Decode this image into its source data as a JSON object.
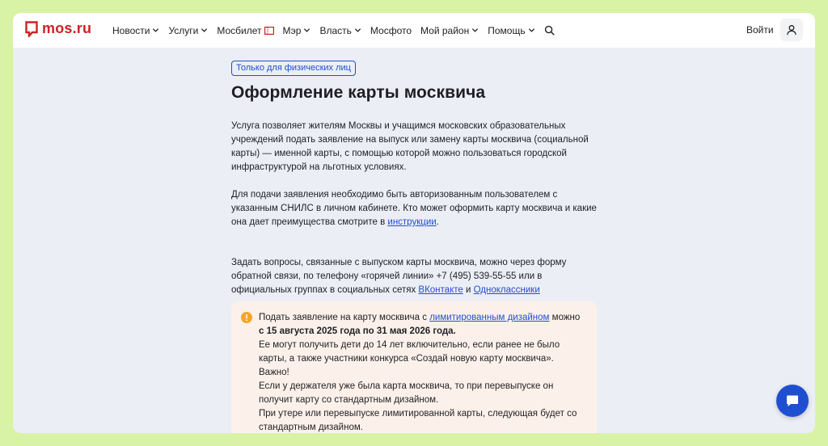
{
  "header": {
    "logo_text": "mos.ru",
    "nav": [
      {
        "label": "Новости",
        "has_dropdown": true
      },
      {
        "label": "Услуги",
        "has_dropdown": true
      },
      {
        "label": "Мосбилет",
        "has_dropdown": false
      },
      {
        "label": "Мэр",
        "has_dropdown": true
      },
      {
        "label": "Власть",
        "has_dropdown": true
      },
      {
        "label": "Мосфото",
        "has_dropdown": false
      },
      {
        "label": "Мой район",
        "has_dropdown": true
      },
      {
        "label": "Помощь",
        "has_dropdown": true
      }
    ],
    "login_label": "Войти"
  },
  "main": {
    "badge": "Только для физических лиц",
    "title": "Оформление карты москвича",
    "intro": "Услуга позволяет жителям Москвы и учащимся московских образовательных учреждений подать заявление на выпуск или замену карты москвича (социальной карты) — именной карты, с помощью которой можно пользоваться городской инфраструктурой на льготных условиях.",
    "auth_text": "Для подачи заявления необходимо быть авторизованным пользователем с указанным СНИЛС в личном кабинете. Кто может оформить карту москвича и какие она дает преимущества смотрите в ",
    "auth_link": "инструкции",
    "auth_end": ".",
    "contact_text": "Задать вопросы, связанные с выпуском карты москвича, можно через форму обратной связи, по телефону «горячей линии» +7 (495) 539-55-55 или в официальных группах в социальных сетях ",
    "vk_link": "ВКонтакте",
    "and_word": " и ",
    "ok_link": "Одноклассники"
  },
  "notice": {
    "line1_start": "Подать заявление на карту москвича с ",
    "line1_link": "лимитированным дизайном",
    "line1_end": " можно",
    "dates": "с 15 августа 2025 года по 31 мая 2026 года.",
    "eligible": "Ее могут получить дети до 14 лет включительно, если ранее не было карты, а также участники конкурса «Создай новую карту москвича».",
    "important": "Важно!",
    "reissue": "Если у держателя уже была карта москвича, то при перевыпуске он получит карту со стандартным дизайном.",
    "lost": "При утере или перевыпуске лимитированной карты, следующая будет со стандартным дизайном."
  },
  "colors": {
    "brand_red": "#cc2229",
    "link_blue": "#1f4fd1",
    "warn_orange": "#f5a623",
    "page_bg": "#ebeef5",
    "notice_bg": "#fcf1ea"
  },
  "icons": [
    "mosru-logo-icon",
    "chevron-down-icon",
    "ticket-icon",
    "search-icon",
    "user-icon",
    "warning-icon",
    "chat-icon"
  ]
}
